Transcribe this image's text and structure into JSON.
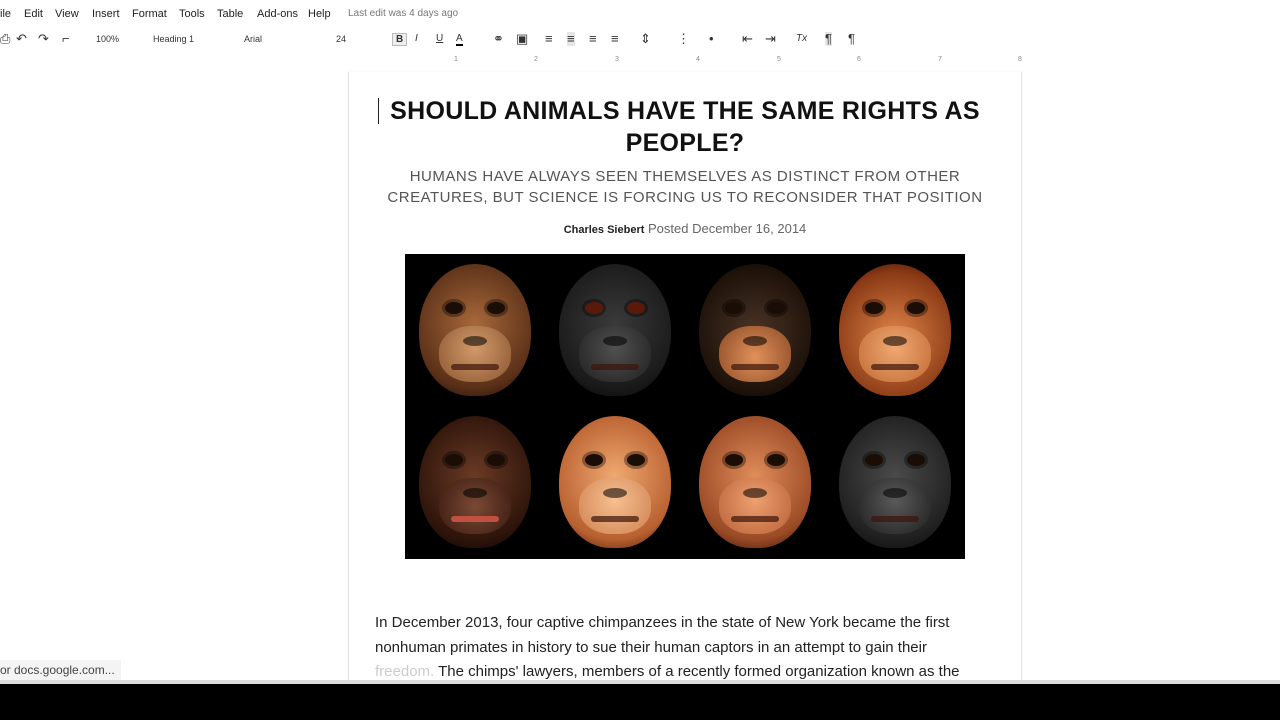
{
  "menu": {
    "items": [
      "ile",
      "Edit",
      "View",
      "Insert",
      "Format",
      "Tools",
      "Table",
      "Add-ons",
      "Help"
    ],
    "last_edit": "Last edit was 4 days ago"
  },
  "toolbar": {
    "zoom": "100%",
    "style": "Heading 1",
    "font": "Arial",
    "size": "24",
    "bold": "B",
    "italic": "I",
    "underline": "U",
    "text_color": "A",
    "clear_format": "Tx"
  },
  "ruler": {
    "marks": [
      "1",
      "2",
      "3",
      "4",
      "5",
      "6",
      "7",
      "8"
    ]
  },
  "article": {
    "title_line1": "SHOULD ANIMALS HAVE THE SAME RIGHTS AS",
    "title_line2": "PEOPLE?",
    "subtitle_line1": "HUMANS HAVE ALWAYS SEEN THEMSELVES AS DISTINCT FROM OTHER",
    "subtitle_line2": "CREATURES, BUT SCIENCE IS FORCING US TO RECONSIDER THAT POSITION",
    "author": "Charles Siebert",
    "posted": "Posted December 16, 2014",
    "image_alt": "eight primate faces",
    "body_line1": "In December 2013, four captive chimpanzees in the state of New York became the first",
    "body_line2": "nonhuman primates in history to sue their human captors in an attempt to gain their",
    "body_line3_faded": "freedom.",
    "body_line3": " The chimps' lawyers, members of a recently formed organization known as the"
  },
  "status": {
    "text": "or docs.google.com..."
  },
  "colors": {
    "page_bg": "#ffffff",
    "text": "#222222",
    "subtitle": "#555555"
  }
}
